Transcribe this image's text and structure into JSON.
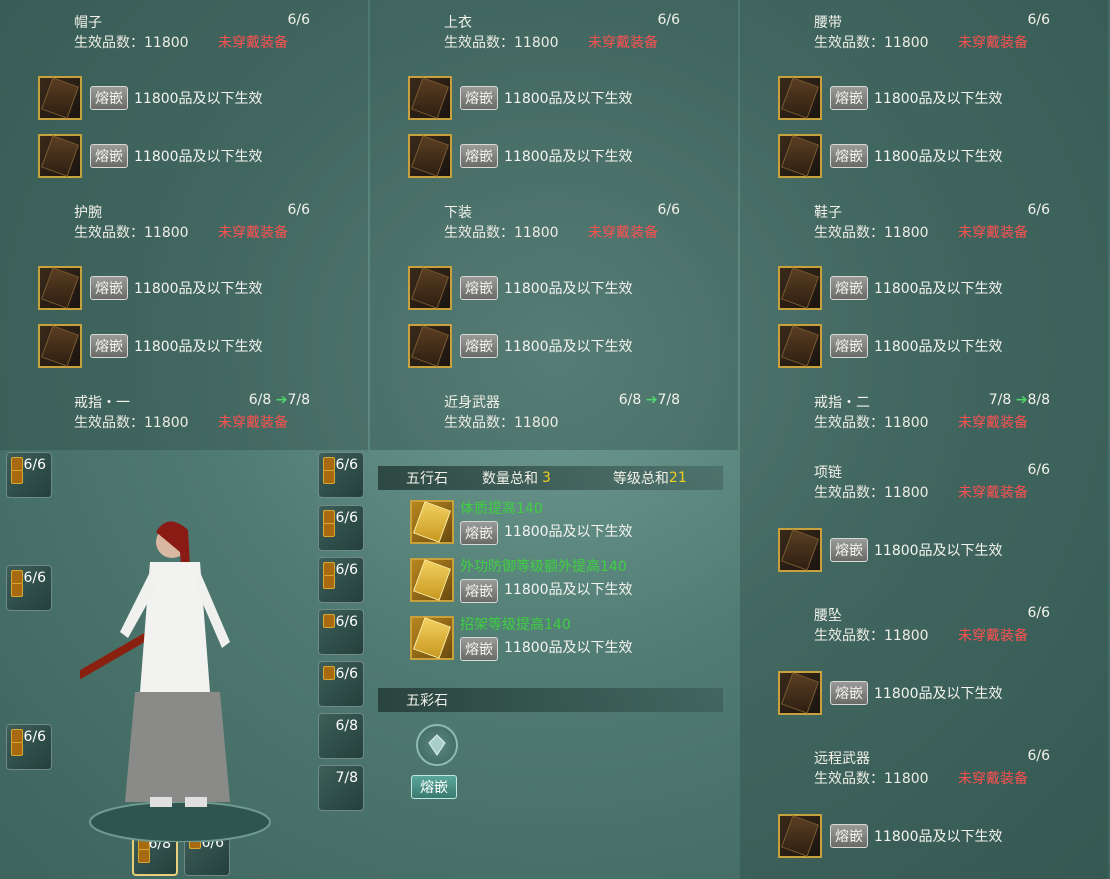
{
  "panels": [
    {
      "title": "帽子",
      "count": "6/6",
      "count_next": "",
      "effect": "生效品数：11800",
      "status": "未穿戴装备",
      "slots": [
        "11800品及以下生效",
        "11800品及以下生效"
      ]
    },
    {
      "title": "上衣",
      "count": "6/6",
      "count_next": "",
      "effect": "生效品数：11800",
      "status": "未穿戴装备",
      "slots": [
        "11800品及以下生效",
        "11800品及以下生效"
      ]
    },
    {
      "title": "腰带",
      "count": "6/6",
      "count_next": "",
      "effect": "生效品数：11800",
      "status": "未穿戴装备",
      "slots": [
        "11800品及以下生效",
        "11800品及以下生效"
      ]
    },
    {
      "title": "护腕",
      "count": "6/6",
      "count_next": "",
      "effect": "生效品数：11800",
      "status": "未穿戴装备",
      "slots": [
        "11800品及以下生效",
        "11800品及以下生效"
      ]
    },
    {
      "title": "下装",
      "count": "6/6",
      "count_next": "",
      "effect": "生效品数：11800",
      "status": "未穿戴装备",
      "slots": [
        "11800品及以下生效",
        "11800品及以下生效"
      ]
    },
    {
      "title": "鞋子",
      "count": "6/6",
      "count_next": "",
      "effect": "生效品数：11800",
      "status": "未穿戴装备",
      "slots": [
        "11800品及以下生效",
        "11800品及以下生效"
      ]
    },
    {
      "title": "戒指・一",
      "count": "6/8",
      "count_next": "7/8",
      "effect": "生效品数：11800",
      "status": "未穿戴装备",
      "slots": []
    },
    {
      "title": "近身武器",
      "count": "6/8",
      "count_next": "7/8",
      "effect": "生效品数：11800",
      "status": "",
      "slots": []
    },
    {
      "title": "戒指・二",
      "count": "7/8",
      "count_next": "8/8",
      "effect": "生效品数：11800",
      "status": "未穿戴装备",
      "slots": []
    },
    {
      "title": "项链",
      "count": "6/6",
      "count_next": "",
      "effect": "生效品数：11800",
      "status": "未穿戴装备",
      "slots": [
        "11800品及以下生效"
      ]
    },
    {
      "title": "腰坠",
      "count": "6/6",
      "count_next": "",
      "effect": "生效品数：11800",
      "status": "未穿戴装备",
      "slots": [
        "11800品及以下生效"
      ]
    },
    {
      "title": "远程武器",
      "count": "6/6",
      "count_next": "",
      "effect": "生效品数：11800",
      "status": "未穿戴装备",
      "slots": [
        "11800品及以下生效"
      ]
    }
  ],
  "inlay_label": "熔嵌",
  "wuxing": {
    "title": "五行石",
    "qty_label": "数量总和",
    "qty_value": "3",
    "level_label": "等级总和",
    "level_value": "21",
    "stones": [
      {
        "name": "体质提高140",
        "text": "11800品及以下生效"
      },
      {
        "name": "外功防御等级额外提高140",
        "text": "11800品及以下生效"
      },
      {
        "name": "招架等级提高140",
        "text": "11800品及以下生效"
      }
    ]
  },
  "wucai": {
    "title": "五彩石",
    "button": "熔嵌"
  },
  "equip_left": [
    {
      "count": "6/6",
      "gems": 2
    },
    {
      "count": "6/6",
      "gems": 2
    },
    {
      "count": "6/6",
      "gems": 2
    }
  ],
  "equip_right": [
    {
      "count": "6/6",
      "gems": 2
    },
    {
      "count": "6/6",
      "gems": 2
    },
    {
      "count": "6/6",
      "gems": 2
    },
    {
      "count": "6/6",
      "gems": 1
    },
    {
      "count": "6/6",
      "gems": 1
    },
    {
      "count": "6/8",
      "gems": 0
    },
    {
      "count": "7/8",
      "gems": 0
    }
  ],
  "equip_bottom": [
    {
      "count": "6/8",
      "gems": 2
    },
    {
      "count": "6/6",
      "gems": 1
    }
  ],
  "colors": {
    "status": "#ff5050",
    "gold_border": "#c8a03c",
    "green": "#3fd040",
    "highlight": "#f0d020"
  }
}
